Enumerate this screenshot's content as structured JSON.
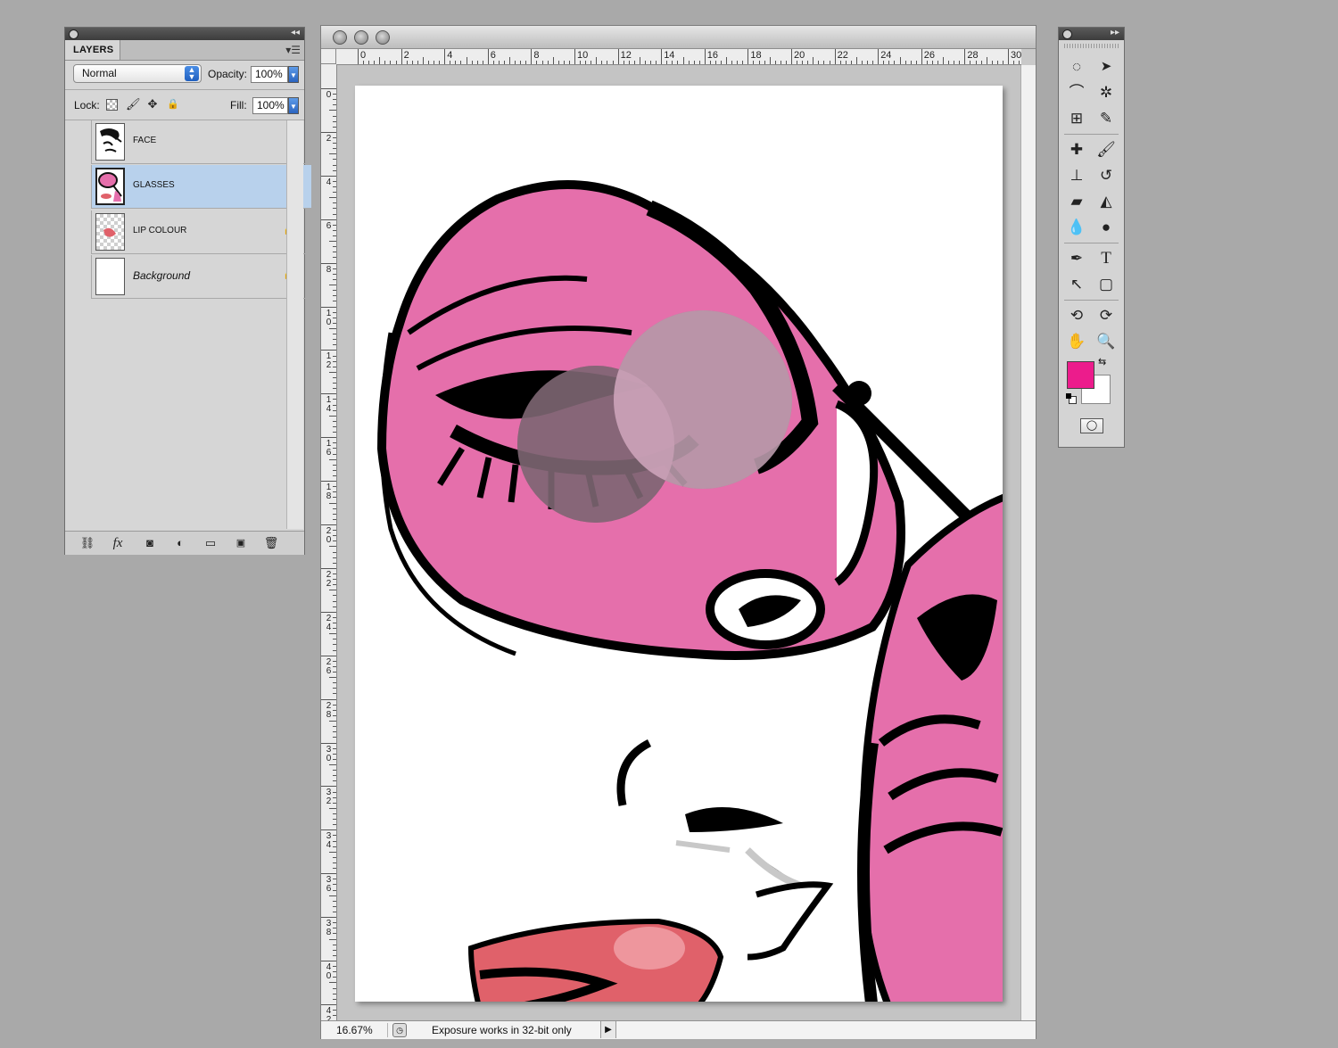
{
  "layers_panel": {
    "tab_label": "LAYERS",
    "blend_mode": "Normal",
    "opacity_label": "Opacity:",
    "opacity_value": "100%",
    "lock_label": "Lock:",
    "fill_label": "Fill:",
    "fill_value": "100%",
    "layers": [
      {
        "name": "FACE",
        "selected": false,
        "locked": false
      },
      {
        "name": "GLASSES",
        "selected": true,
        "locked": false
      },
      {
        "name": "LIP COLOUR",
        "selected": false,
        "locked": true
      },
      {
        "name": "Background",
        "selected": false,
        "locked": true
      }
    ],
    "bottom_icons": [
      "link-icon",
      "fx-icon",
      "mask-icon",
      "adjustment-icon",
      "folder-icon",
      "new-layer-icon",
      "trash-icon"
    ],
    "fx_label": "fx"
  },
  "document": {
    "ruler_h_labels": [
      "0",
      "2",
      "4",
      "6",
      "8",
      "10",
      "12",
      "14",
      "16",
      "18",
      "20",
      "22",
      "24",
      "26",
      "28",
      "30"
    ],
    "ruler_v_labels": [
      "0",
      "2",
      "4",
      "6",
      "8",
      "10",
      "12",
      "14",
      "16",
      "18",
      "20",
      "22",
      "24",
      "26",
      "28",
      "30",
      "32",
      "34",
      "36",
      "38",
      "40",
      "42"
    ],
    "zoom": "16.67%",
    "status_text": "Exposure works in 32-bit only",
    "colors": {
      "pink": "#e56fab",
      "lip": "#e0616a",
      "black": "#000000"
    }
  },
  "tools_panel": {
    "tools": [
      "marquee-tool",
      "move-tool",
      "lasso-tool",
      "magic-wand-tool",
      "crop-tool",
      "eyedropper-tool",
      "healing-brush-tool",
      "brush-tool",
      "clone-stamp-tool",
      "history-brush-tool",
      "eraser-tool",
      "paint-bucket-tool",
      "blur-tool",
      "dodge-tool",
      "pen-tool",
      "type-tool",
      "path-selection-tool",
      "shape-tool",
      "3d-rotate-tool",
      "3d-orbit-tool",
      "hand-tool",
      "zoom-tool"
    ],
    "type_tool_glyph": "T",
    "foreground_color": "#ec1c8c",
    "background_color": "#ffffff"
  }
}
